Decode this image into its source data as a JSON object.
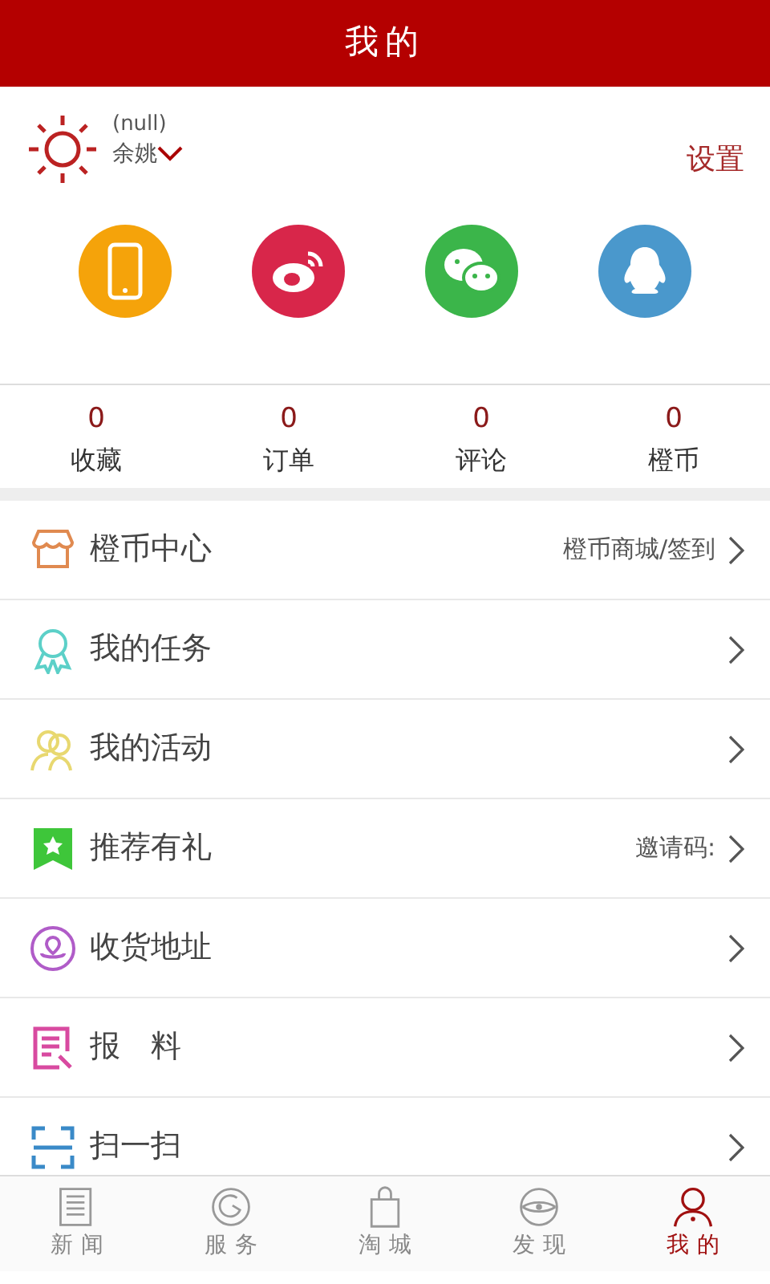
{
  "header": {
    "title": "我的"
  },
  "profile": {
    "name": "(null)",
    "location": "余姚",
    "settings": "设置"
  },
  "stats": [
    {
      "value": "0",
      "label": "收藏"
    },
    {
      "value": "0",
      "label": "订单"
    },
    {
      "value": "0",
      "label": "评论"
    },
    {
      "value": "0",
      "label": "橙币"
    }
  ],
  "menu": [
    {
      "label": "橙币中心",
      "detail": "橙币商城/签到"
    },
    {
      "label": "我的任务"
    },
    {
      "label": "我的活动"
    },
    {
      "label": "推荐有礼",
      "detail": "邀请码:"
    },
    {
      "label": "收货地址"
    },
    {
      "label": "报　料"
    },
    {
      "label": "扫一扫"
    }
  ],
  "tabs": [
    {
      "label": "新闻",
      "selected": false
    },
    {
      "label": "服务",
      "selected": false
    },
    {
      "label": "淘城",
      "selected": false
    },
    {
      "label": "发现",
      "selected": false
    },
    {
      "label": "我的",
      "selected": true
    }
  ]
}
